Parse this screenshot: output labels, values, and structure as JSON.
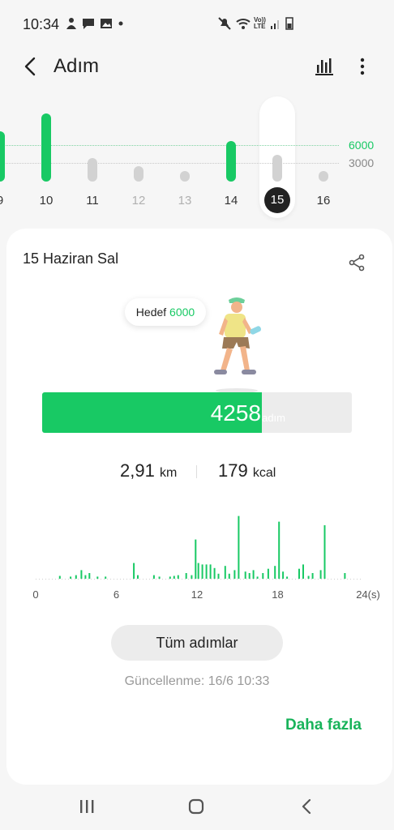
{
  "status_bar": {
    "time": "10:34",
    "left_icons": [
      "bixby-icon",
      "message-icon",
      "gallery-icon",
      "dot-icon"
    ],
    "right_icons": [
      "mute-icon",
      "wifi-icon",
      "volte-icon",
      "signal-icon",
      "battery-icon"
    ],
    "volte_label": "Vo)) LTE"
  },
  "app_bar": {
    "title": "Adım"
  },
  "week": {
    "goal_label": "6000",
    "mid_label": "3000",
    "days": [
      "9",
      "10",
      "11",
      "12",
      "13",
      "14",
      "15",
      "16"
    ],
    "selected_day": "15",
    "accent": "#18c964"
  },
  "card": {
    "date": "15 Haziran Sal",
    "goal_prefix": "Hedef",
    "goal_value": "6000",
    "steps": "4258",
    "steps_unit": "adım",
    "progress_fraction": 0.7097,
    "distance_value": "2,91",
    "distance_unit": "km",
    "calories_value": "179",
    "calories_unit": "kcal",
    "all_steps_button": "Tüm adımlar",
    "updated": "Güncellenme: 16/6 10:33",
    "more_link": "Daha fazla"
  },
  "chart_data": {
    "type": "bar",
    "title": "",
    "x_tick_labels": [
      "0",
      "6",
      "12",
      "18",
      "24(s)"
    ],
    "xlim": [
      0,
      24
    ],
    "x": [
      1.8,
      2.6,
      3.0,
      3.4,
      3.7,
      4.0,
      4.6,
      5.2,
      7.3,
      7.6,
      8.8,
      9.2,
      10.0,
      10.3,
      10.6,
      11.2,
      11.6,
      11.9,
      12.1,
      12.4,
      12.7,
      13.0,
      13.3,
      13.6,
      14.1,
      14.4,
      14.8,
      15.1,
      15.6,
      15.9,
      16.2,
      16.5,
      16.9,
      17.3,
      17.8,
      18.1,
      18.4,
      18.7,
      19.6,
      19.9,
      20.3,
      20.6,
      21.2,
      21.5,
      23.0
    ],
    "values": [
      4,
      3,
      5,
      12,
      5,
      8,
      3,
      3,
      22,
      5,
      5,
      3,
      3,
      4,
      5,
      8,
      5,
      55,
      22,
      20,
      20,
      20,
      15,
      7,
      18,
      7,
      12,
      88,
      10,
      8,
      12,
      3,
      8,
      14,
      18,
      80,
      10,
      3,
      14,
      20,
      4,
      8,
      12,
      75,
      8
    ],
    "ylim": [
      0,
      100
    ]
  }
}
